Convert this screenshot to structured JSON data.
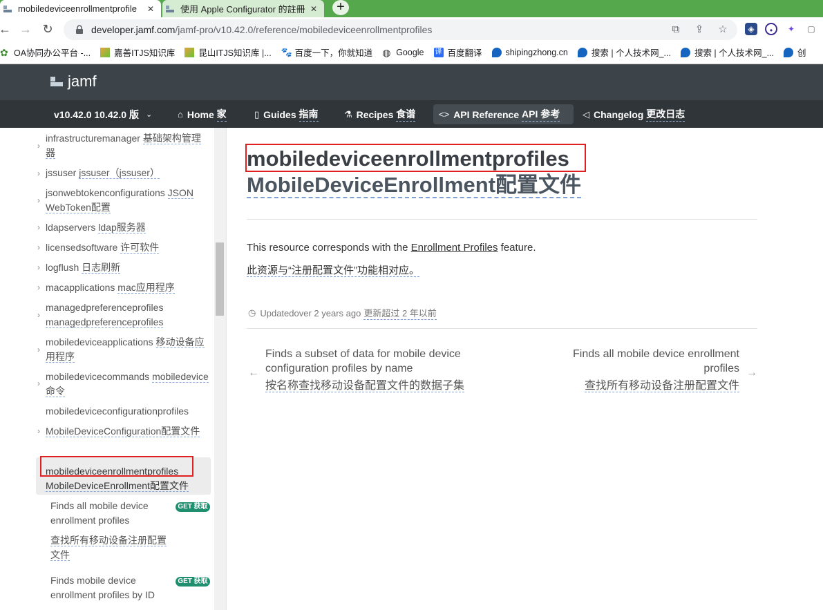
{
  "browser": {
    "tabs": [
      {
        "title": "mobiledeviceenrollmentprofile",
        "active": true
      },
      {
        "title": "使用 Apple Configurator 的註冊",
        "active": false
      }
    ],
    "new_tab": "+",
    "url_host": "developer.jamf.com",
    "url_path": "/jamf-pro/v10.42.0/reference/mobiledeviceenrollmentprofiles",
    "bookmarks": [
      "OA协同办公平台 -...",
      "嘉善ITJS知识库",
      "昆山ITJS知识库 |...",
      "百度一下，你就知道",
      "Google",
      "百度翻译",
      "shipingzhong.cn",
      "搜索 | 个人技术网_...",
      "搜索 | 个人技术网_...",
      "创"
    ]
  },
  "jamf": {
    "logo_text": "jamf",
    "nav": [
      {
        "label": "v10.42.0 10.42.0 版",
        "icon": "chevron-down"
      },
      {
        "label": "Home",
        "zh": "家",
        "icon": "home"
      },
      {
        "label": "Guides",
        "zh": "指南",
        "icon": "book"
      },
      {
        "label": "Recipes",
        "zh": "食谱",
        "icon": "flask"
      },
      {
        "label": "API Reference",
        "zh": "API 参考",
        "icon": "code"
      },
      {
        "label": "Changelog",
        "zh": "更改日志",
        "icon": "megaphone"
      }
    ]
  },
  "sidebar": {
    "items": [
      {
        "en": "infrastructuremanager",
        "zh": "基础架构管理器"
      },
      {
        "en": "jssuser",
        "zh": "jssuser（jssuser）"
      },
      {
        "en": "jsonwebtokenconfigurations",
        "zh": "JSON WebToken配置"
      },
      {
        "en": "ldapservers",
        "zh": "ldap服务器"
      },
      {
        "en": "licensedsoftware",
        "zh": "许可软件"
      },
      {
        "en": "logflush",
        "zh": "日志刷新"
      },
      {
        "en": "macapplications",
        "zh": "mac应用程序"
      },
      {
        "en": "managedpreferenceprofiles",
        "zh": "managedpreferenceprofiles"
      },
      {
        "en": "mobiledeviceapplications",
        "zh": "移动设备应用程序"
      },
      {
        "en": "mobiledevicecommands",
        "zh": "mobiledevice命令"
      },
      {
        "en": "mobiledeviceconfigurationprofiles",
        "zh": ""
      },
      {
        "en": "",
        "zh": "MobileDeviceConfiguration配置文件"
      },
      {
        "en": "mobiledeviceenrollmentprofiles",
        "zh": "MobileDeviceEnrollment配置文件"
      }
    ],
    "sub_items": [
      {
        "en": "Finds all mobile device enrollment profiles",
        "zh": "查找所有移动设备注册配置文件",
        "badge": "GET 获取"
      },
      {
        "en": "Finds mobile device enrollment profiles by ID",
        "zh": "",
        "badge": "GET 获取"
      }
    ]
  },
  "main": {
    "title_en": "mobiledeviceenrollmentprofiles",
    "title_zh": "MobileDeviceEnrollment配置文件",
    "desc_prefix": "This resource corresponds with the ",
    "desc_link": "Enrollment Profiles",
    "desc_suffix": " feature.",
    "desc_zh": "此资源与“注册配置文件”功能相对应。",
    "updated_en": "Updatedover 2 years ago",
    "updated_zh": "更新超过 2 年以前",
    "prev": {
      "en": "Finds a subset of data for mobile device configuration profiles by name",
      "zh": "按名称查找移动设备配置文件的数据子集"
    },
    "next": {
      "en": "Finds all mobile device enrollment profiles",
      "zh": "查找所有移动设备注册配置文件"
    }
  }
}
